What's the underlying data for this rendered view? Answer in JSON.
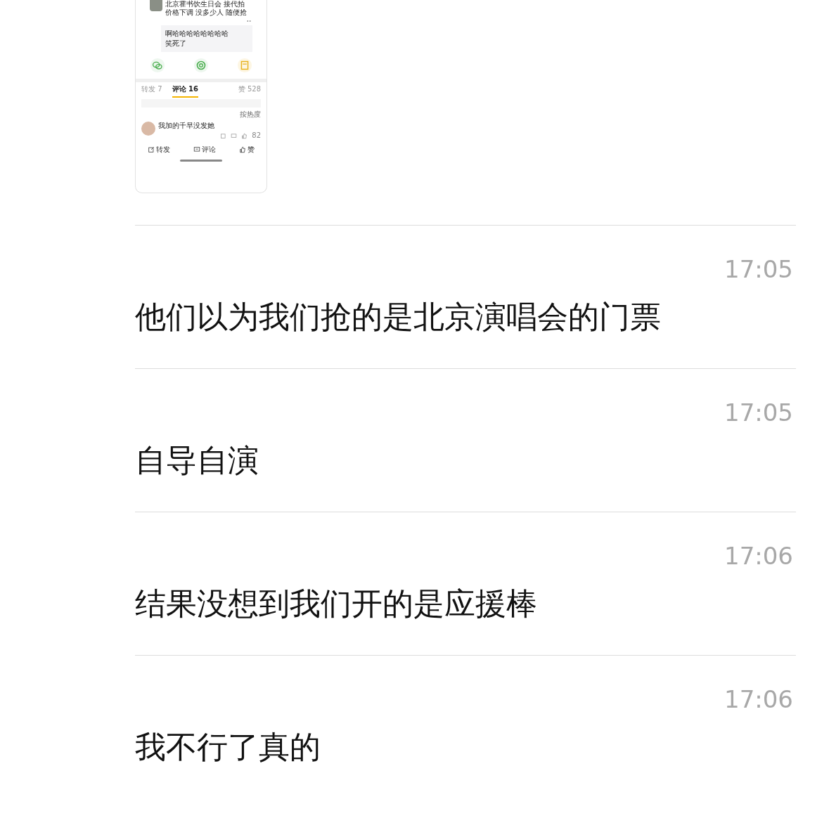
{
  "shared_screenshot": {
    "post_lines": [
      "北京霍书饮生日会 接代拍",
      "价格下调 没多少人 随便抢"
    ],
    "quoted_replies": [
      "啊哈哈哈哈哈哈哈哈",
      "笑死了"
    ],
    "tabs": [
      {
        "label": "转发 7",
        "selected": false
      },
      {
        "label": "评论 16",
        "selected": true
      },
      {
        "label": "赞 528",
        "selected": false
      }
    ],
    "sort_label": "按热度",
    "comment": {
      "text": "我加的千早没发她",
      "likes": "82"
    },
    "actions": [
      "转发",
      "评论",
      "赞"
    ]
  },
  "messages": [
    {
      "time": "17:05",
      "text": "他们以为我们抢的是北京演唱会的门票"
    },
    {
      "time": "17:05",
      "text": "自导自演"
    },
    {
      "time": "17:06",
      "text": "结果没想到我们开的是应援棒"
    },
    {
      "time": "17:06",
      "text": "我不行了真的"
    }
  ]
}
